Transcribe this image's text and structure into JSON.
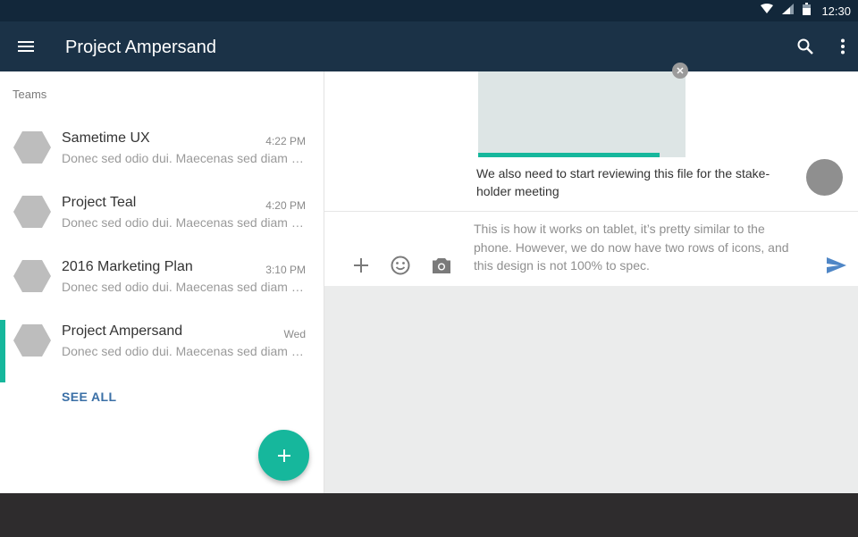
{
  "status_bar": {
    "time": "12:30",
    "icons": [
      "wifi-icon",
      "signal-icon",
      "battery-icon"
    ]
  },
  "app_bar": {
    "title": "Project Ampersand",
    "icons": [
      "menu-icon",
      "search-icon",
      "more-vert-icon"
    ]
  },
  "sidebar": {
    "heading": "Teams",
    "teams": [
      {
        "name": "Sametime UX",
        "time": "4:22 PM",
        "preview": "Donec sed odio dui. Maecenas sed diam eget risus",
        "active": false
      },
      {
        "name": "Project Teal",
        "time": "4:20 PM",
        "preview": "Donec sed odio dui. Maecenas sed diam eget risus",
        "active": false
      },
      {
        "name": "2016 Marketing Plan",
        "time": "3:10 PM",
        "preview": "Donec sed odio dui. Maecenas sed diam eget risus",
        "active": false
      },
      {
        "name": "Project Ampersand",
        "time": "Wed",
        "preview": "Donec sed odio dui. Maecenas sed diam eget risus",
        "active": true
      }
    ],
    "see_all": "SEE ALL",
    "fab_icon": "add-icon"
  },
  "chat": {
    "attachment_upload_progress": 0.875,
    "message_text": "We also need to start reviewing this file for the stake-holder meeting",
    "composer_text": "This is how it works on tablet, it’s pretty similar to the phone. However, we do now have two rows of icons, and this design is not 100% to spec.",
    "composer_icons": [
      "add-icon",
      "emoji-icon",
      "camera-icon",
      "send-icon"
    ]
  },
  "colors": {
    "app_bar": "#1b3247",
    "status_bar": "#12273a",
    "accent": "#16b79c",
    "link": "#3a6fa6",
    "send": "#4f86c6"
  }
}
